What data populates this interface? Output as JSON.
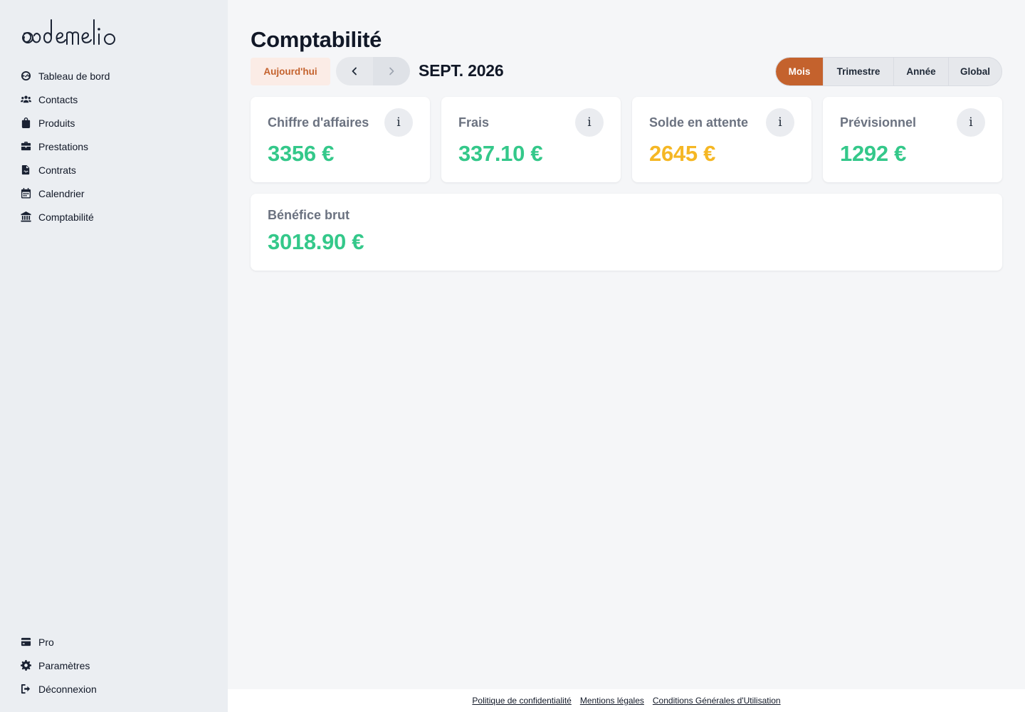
{
  "app": {
    "logo_text": "ademelio"
  },
  "sidebar": {
    "items": [
      {
        "label": "Tableau de bord",
        "icon": "dashboard-icon"
      },
      {
        "label": "Contacts",
        "icon": "users-icon"
      },
      {
        "label": "Produits",
        "icon": "bag-icon"
      },
      {
        "label": "Prestations",
        "icon": "briefcase-icon"
      },
      {
        "label": "Contrats",
        "icon": "contract-icon"
      },
      {
        "label": "Calendrier",
        "icon": "calendar-icon"
      },
      {
        "label": "Comptabilité",
        "icon": "bank-icon"
      }
    ],
    "bottom_items": [
      {
        "label": "Pro",
        "icon": "credit-card-icon"
      },
      {
        "label": "Paramètres",
        "icon": "gear-icon"
      },
      {
        "label": "Déconnexion",
        "icon": "logout-icon"
      }
    ]
  },
  "main": {
    "title": "Comptabilité",
    "today_button": "Aujourd'hui",
    "period_label": "SEPT. 2026",
    "periods": [
      "Mois",
      "Trimestre",
      "Année",
      "Global"
    ],
    "active_period": "Mois",
    "cards": [
      {
        "label": "Chiffre d'affaires",
        "value": "3356 €",
        "color": "#34c88a",
        "info": "i"
      },
      {
        "label": "Frais",
        "value": "337.10 €",
        "color": "#34c88a",
        "info": "i"
      },
      {
        "label": "Solde en attente",
        "value": "2645 €",
        "color": "#f5b724",
        "info": "i"
      },
      {
        "label": "Prévisionnel",
        "value": "1292 €",
        "color": "#34c88a",
        "info": "i"
      }
    ],
    "profit": {
      "label": "Bénéfice brut",
      "value": "3018.90 €",
      "color": "#34c88a"
    }
  },
  "footer": {
    "links": [
      "Politique de confidentialité",
      "Mentions légales",
      "Conditions Générales d'Utilisation"
    ]
  },
  "colors": {
    "accent": "#c4622d",
    "positive": "#34c88a",
    "pending": "#f5b724"
  }
}
